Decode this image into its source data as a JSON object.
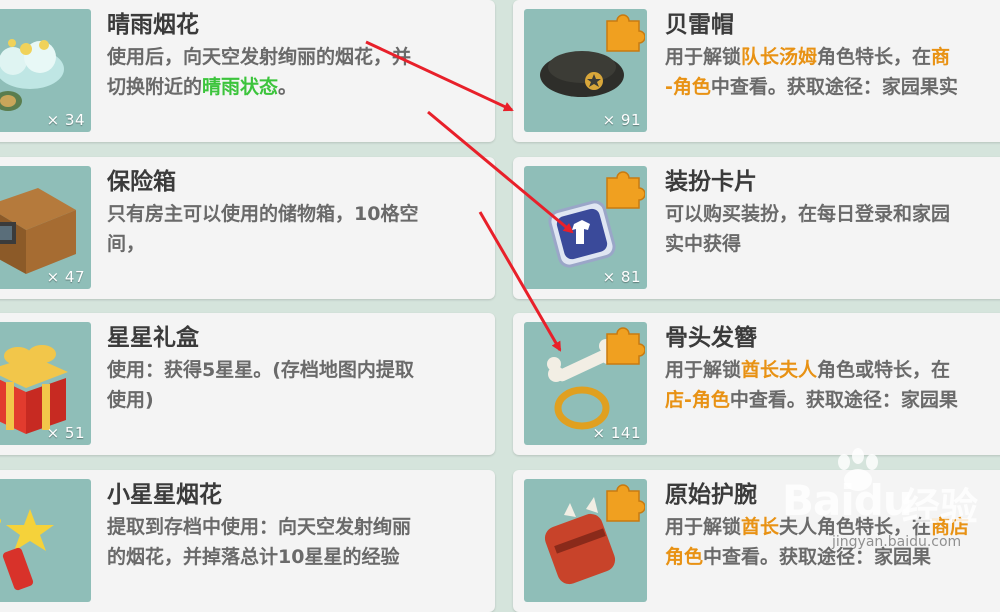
{
  "items_left": [
    {
      "name": "晴雨烟花",
      "count": "× 34",
      "desc_lines": [
        [
          {
            "t": "使用后，向天空发射绚丽的烟花，并",
            "c": ""
          }
        ],
        [
          {
            "t": "切换附近的",
            "c": ""
          },
          {
            "t": "晴雨状态",
            "c": "green"
          },
          {
            "t": "。",
            "c": ""
          }
        ]
      ],
      "icon": "firework-icon"
    },
    {
      "name": "保险箱",
      "count": "× 47",
      "desc_lines": [
        [
          {
            "t": "只有房主可以使用的储物箱，10格空",
            "c": ""
          }
        ],
        [
          {
            "t": "间，",
            "c": ""
          }
        ]
      ],
      "icon": "safe-box-icon"
    },
    {
      "name": "星星礼盒",
      "count": "× 51",
      "desc_lines": [
        [
          {
            "t": "使用：获得5星星。(存档地图内提取",
            "c": ""
          }
        ],
        [
          {
            "t": "使用)",
            "c": ""
          }
        ]
      ],
      "icon": "gift-box-icon"
    },
    {
      "name": "小星星烟花",
      "count": "",
      "desc_lines": [
        [
          {
            "t": "提取到存档中使用：向天空发射绚丽",
            "c": ""
          }
        ],
        [
          {
            "t": "的烟花，并掉落总计10星星的经验",
            "c": ""
          }
        ]
      ],
      "icon": "star-firework-icon"
    }
  ],
  "items_right": [
    {
      "name": "贝雷帽",
      "count": "× 91",
      "desc_lines": [
        [
          {
            "t": "用于解锁",
            "c": ""
          },
          {
            "t": "队长汤姆",
            "c": "orange"
          },
          {
            "t": "角色特长，在",
            "c": ""
          },
          {
            "t": "商",
            "c": "orange"
          }
        ],
        [
          {
            "t": "-角色",
            "c": "orange"
          },
          {
            "t": "中查看。获取途径：家园果实",
            "c": ""
          }
        ]
      ],
      "icon": "beret-icon"
    },
    {
      "name": "装扮卡片",
      "count": "× 81",
      "desc_lines": [
        [
          {
            "t": "可以购买装扮，在每日登录和家园",
            "c": ""
          }
        ],
        [
          {
            "t": "实中获得",
            "c": ""
          }
        ]
      ],
      "icon": "outfit-card-icon"
    },
    {
      "name": "骨头发簪",
      "count": "× 141",
      "desc_lines": [
        [
          {
            "t": "用于解锁",
            "c": ""
          },
          {
            "t": "酋长夫人",
            "c": "orange"
          },
          {
            "t": "角色或特长，在",
            "c": ""
          }
        ],
        [
          {
            "t": "店-角色",
            "c": "orange"
          },
          {
            "t": "中查看。获取途径：家园果",
            "c": ""
          }
        ]
      ],
      "icon": "bone-hairpin-icon"
    },
    {
      "name": "原始护腕",
      "count": "",
      "desc_lines": [
        [
          {
            "t": "用于解锁",
            "c": ""
          },
          {
            "t": "酋长",
            "c": "orange"
          },
          {
            "t": "夫人角色特长，在",
            "c": ""
          },
          {
            "t": "商店",
            "c": "orange"
          }
        ],
        [
          {
            "t": "角色",
            "c": "orange"
          },
          {
            "t": "中查看。获取途径：家园果",
            "c": ""
          }
        ]
      ],
      "icon": "primitive-bracer-icon"
    }
  ],
  "watermark": {
    "brand": "Bai",
    "brand2": "du",
    "cn": "经验",
    "sub": "jingyan.baidu.com"
  },
  "colors": {
    "highlight_green": "#3cc43c",
    "highlight_orange": "#e89214",
    "arrow": "#e8202a",
    "thumb_bg": "#8fbeb8"
  }
}
